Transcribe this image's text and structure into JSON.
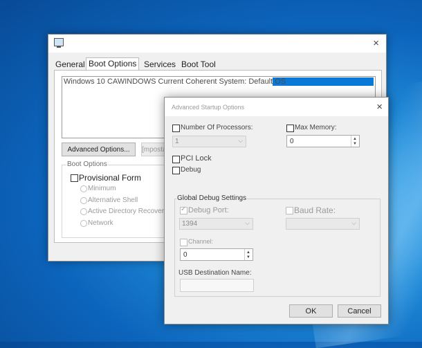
{
  "main_window": {
    "tabs": [
      {
        "label": "General"
      },
      {
        "label": "Boot Options"
      },
      {
        "label": "Services"
      },
      {
        "label": "Boot Tool"
      }
    ],
    "os_entry": "Windows 10 CAWINDOWS Current Coherent System: Default OS",
    "advanced_button": "Advanced Options...",
    "set_default_button": "[mposta",
    "boot_options_title": "Boot Options",
    "provisional_form_label": "Provisional Form",
    "radios": [
      "Minimum",
      "Alternative Shell",
      "Active Directory Recovery",
      "Network"
    ]
  },
  "advanced_dialog": {
    "title": "Advanced Startup Options",
    "num_processors_label": "Number Of Processors:",
    "num_processors_value": "1",
    "max_memory_label": "Max Memory:",
    "max_memory_value": "0",
    "pci_lock_label": "PCI Lock",
    "debug_label": "Debug",
    "global_debug_title": "Global Debug Settings",
    "debug_port_label": "Debug Port:",
    "debug_port_value": "1394",
    "baud_rate_label": "Baud Rate:",
    "channel_label": "Channel:",
    "channel_value": "0",
    "usb_dest_label": "USB Destination Name:",
    "ok_label": "OK",
    "cancel_label": "Cancel"
  },
  "icons": {
    "close": "×",
    "dropdown": "⌵"
  },
  "colors": {
    "selection": "#0a78d7",
    "desktop": "#1f8ad8"
  }
}
